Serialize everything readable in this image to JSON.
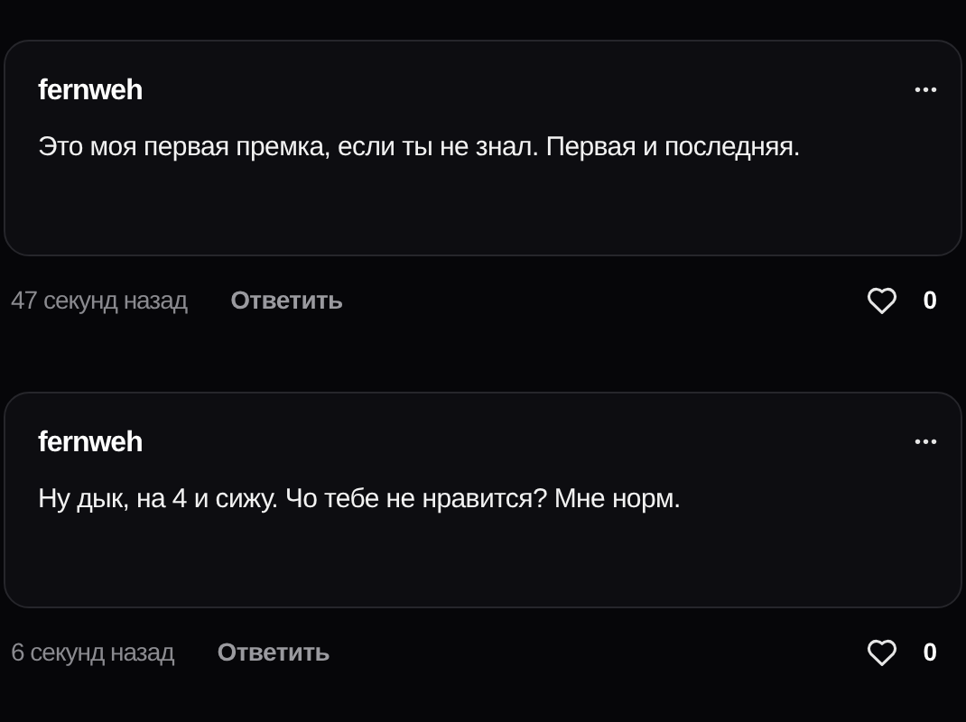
{
  "comments": [
    {
      "author": "fernweh",
      "menu": "•••",
      "text": "Это моя первая премка, если ты не знал. Первая и последняя.",
      "time": "47 секунд назад",
      "reply": "Ответить",
      "liked": false,
      "likes": "0"
    },
    {
      "author": "fernweh",
      "menu": "•••",
      "text": "Ну дык, на 4 и сижу. Чо тебе не нравится? Мне норм.",
      "time": "6 секунд назад",
      "reply": "Ответить",
      "liked": false,
      "likes": "0"
    }
  ]
}
